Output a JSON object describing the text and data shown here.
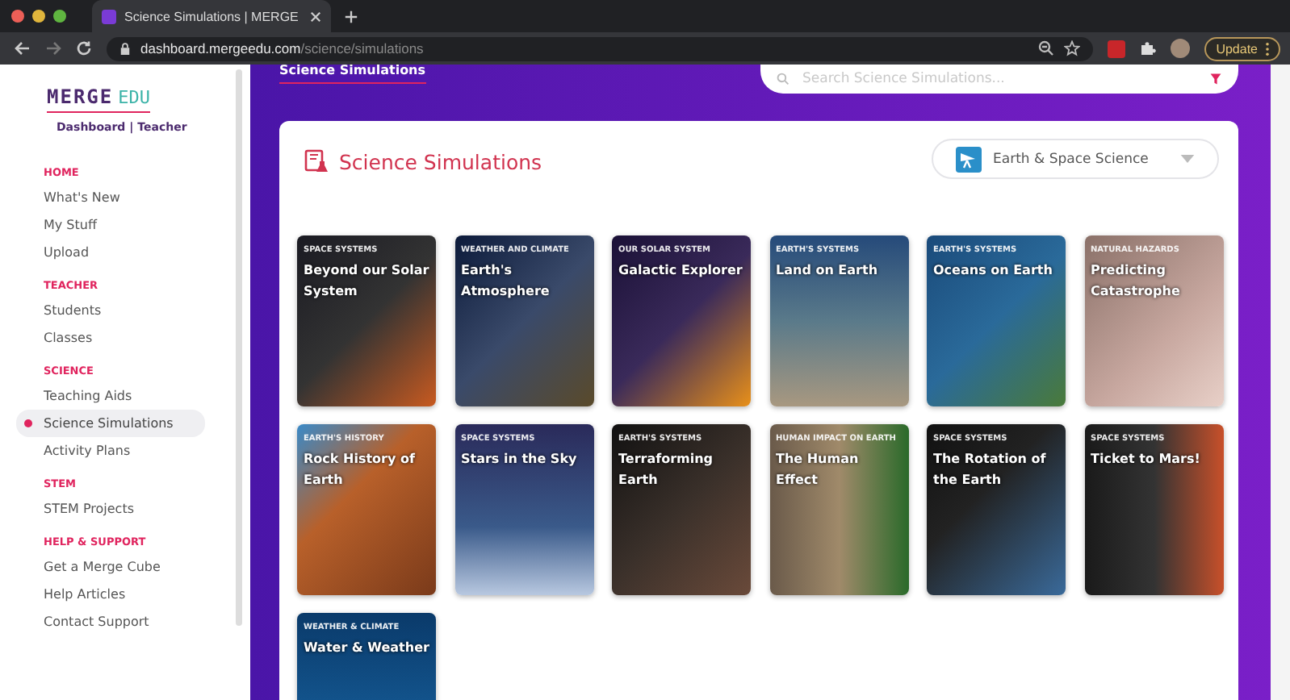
{
  "browser": {
    "tab_title": "Science Simulations | MERGE",
    "url_host": "dashboard.mergeedu.com",
    "url_path": "/science/simulations",
    "update_button": "Update"
  },
  "sidebar": {
    "logo_main": "MERGE",
    "logo_sub": "EDU",
    "subtitle": "Dashboard | Teacher",
    "sections": [
      {
        "heading": "HOME",
        "items": [
          {
            "label": "What's New",
            "selected": false
          },
          {
            "label": "My Stuff",
            "selected": false
          },
          {
            "label": "Upload",
            "selected": false
          }
        ]
      },
      {
        "heading": "TEACHER",
        "items": [
          {
            "label": "Students",
            "selected": false
          },
          {
            "label": "Classes",
            "selected": false
          }
        ]
      },
      {
        "heading": "SCIENCE",
        "items": [
          {
            "label": "Teaching Aids",
            "selected": false
          },
          {
            "label": "Science Simulations",
            "selected": true
          },
          {
            "label": "Activity Plans",
            "selected": false
          }
        ]
      },
      {
        "heading": "STEM",
        "items": [
          {
            "label": "STEM Projects",
            "selected": false
          }
        ]
      },
      {
        "heading": "HELP & SUPPORT",
        "items": [
          {
            "label": "Get a Merge Cube",
            "selected": false
          },
          {
            "label": "Help Articles",
            "selected": false
          },
          {
            "label": "Contact Support",
            "selected": false
          }
        ]
      }
    ]
  },
  "header": {
    "page_tab": "Science Simulations",
    "search": {
      "placeholder": "Search Science Simulations..."
    }
  },
  "panel": {
    "title": "Science Simulations",
    "dropdown": "Earth & Space Science",
    "simulations": [
      {
        "category": "SPACE SYSTEMS",
        "title": "Beyond our Solar System"
      },
      {
        "category": "WEATHER AND CLIMATE",
        "title": "Earth's Atmosphere"
      },
      {
        "category": "OUR SOLAR SYSTEM",
        "title": "Galactic Explorer"
      },
      {
        "category": "EARTH'S SYSTEMS",
        "title": "Land on Earth"
      },
      {
        "category": "EARTH'S SYSTEMS",
        "title": "Oceans on Earth"
      },
      {
        "category": "NATURAL HAZARDS",
        "title": "Predicting Catastrophe"
      },
      {
        "category": "EARTH'S HISTORY",
        "title": "Rock History of Earth"
      },
      {
        "category": "SPACE SYSTEMS",
        "title": "Stars in the Sky"
      },
      {
        "category": "EARTH'S SYSTEMS",
        "title": "Terraforming Earth"
      },
      {
        "category": "HUMAN IMPACT ON EARTH",
        "title": "The Human Effect"
      },
      {
        "category": "SPACE SYSTEMS",
        "title": "The Rotation of the Earth"
      },
      {
        "category": "SPACE SYSTEMS",
        "title": "Ticket to Mars!"
      },
      {
        "category": "WEATHER & CLIMATE",
        "title": "Water & Weather"
      }
    ]
  }
}
